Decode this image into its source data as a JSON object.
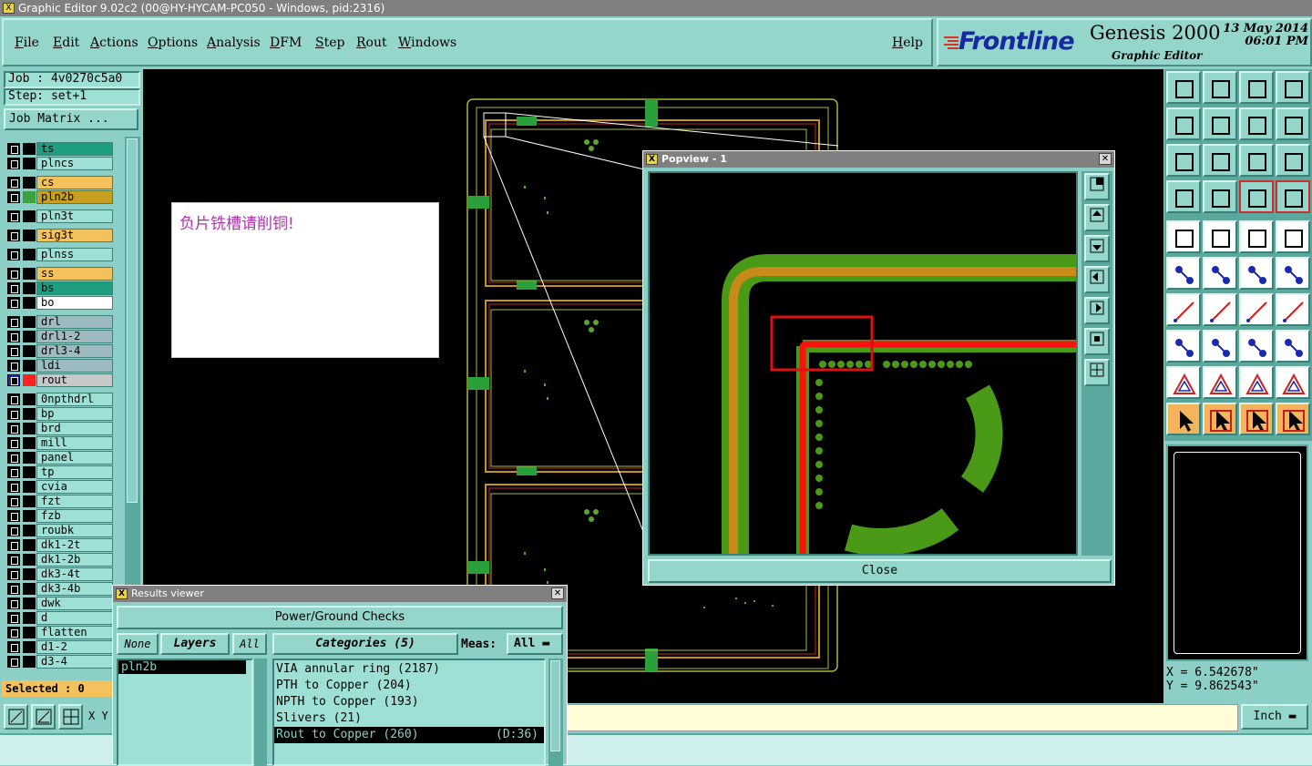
{
  "window": {
    "title": "Graphic Editor 9.02c2 (00@HY-HYCAM-PC050 - Windows, pid:2316)"
  },
  "menu": [
    "File",
    "Edit",
    "Actions",
    "Options",
    "Analysis",
    "DFM",
    "Step",
    "Rout",
    "Windows"
  ],
  "help": "Help",
  "brand": {
    "logo": "Frontline",
    "product": "Genesis 2000",
    "subtitle": "Graphic Editor",
    "date": "13 May 2014",
    "time": "06:01 PM"
  },
  "job": {
    "label": "Job : 4v0270c5a0",
    "step": "Step: set+1",
    "matrix_button": "Job Matrix ..."
  },
  "layers": [
    {
      "name": "ts",
      "color": "#1e9e7e",
      "swatch": "#000"
    },
    {
      "name": "plncs",
      "color": "#9ee0d6",
      "swatch": "#000"
    },
    {
      "name": "cs",
      "color": "#f4c25c",
      "swatch": "#000"
    },
    {
      "name": "pln2b",
      "color": "#c8a020",
      "swatch": "#3aa040"
    },
    {
      "name": "pln3t",
      "color": "#9ee0d6",
      "swatch": "#000"
    },
    {
      "name": "sig3t",
      "color": "#f4c25c",
      "swatch": "#000"
    },
    {
      "name": "plnss",
      "color": "#9ee0d6",
      "swatch": "#000"
    },
    {
      "name": "ss",
      "color": "#f4c25c",
      "swatch": "#000"
    },
    {
      "name": "bs",
      "color": "#1e9e7e",
      "swatch": "#000"
    },
    {
      "name": "bo",
      "color": "#ffffff",
      "swatch": "#000"
    },
    {
      "name": "drl",
      "color": "#9cbac0",
      "swatch": "#000"
    },
    {
      "name": "drl1-2",
      "color": "#9cbac0",
      "swatch": "#000"
    },
    {
      "name": "drl3-4",
      "color": "#9cbac0",
      "swatch": "#000"
    },
    {
      "name": "ldi",
      "color": "#9cbac0",
      "swatch": "#000"
    },
    {
      "name": "rout",
      "color": "#c8c8c8",
      "swatch": "#ff2020"
    },
    {
      "name": "0npthdrl",
      "color": "#9ee0d6",
      "swatch": "#000"
    },
    {
      "name": "bp",
      "color": "#9ee0d6",
      "swatch": "#000"
    },
    {
      "name": "brd",
      "color": "#9ee0d6",
      "swatch": "#000"
    },
    {
      "name": "mill",
      "color": "#9ee0d6",
      "swatch": "#000"
    },
    {
      "name": "panel",
      "color": "#9ee0d6",
      "swatch": "#000"
    },
    {
      "name": "tp",
      "color": "#9ee0d6",
      "swatch": "#000"
    },
    {
      "name": "cvia",
      "color": "#9ee0d6",
      "swatch": "#000"
    },
    {
      "name": "fzt",
      "color": "#9ee0d6",
      "swatch": "#000"
    },
    {
      "name": "fzb",
      "color": "#9ee0d6",
      "swatch": "#000"
    },
    {
      "name": "roubk",
      "color": "#9ee0d6",
      "swatch": "#000"
    },
    {
      "name": "dk1-2t",
      "color": "#9ee0d6",
      "swatch": "#000"
    },
    {
      "name": "dk1-2b",
      "color": "#9ee0d6",
      "swatch": "#000"
    },
    {
      "name": "dk3-4t",
      "color": "#9ee0d6",
      "swatch": "#000"
    },
    {
      "name": "dk3-4b",
      "color": "#9ee0d6",
      "swatch": "#000"
    },
    {
      "name": "dwk",
      "color": "#9ee0d6",
      "swatch": "#000"
    },
    {
      "name": "d",
      "color": "#9ee0d6",
      "swatch": "#000"
    },
    {
      "name": "flatten",
      "color": "#9ee0d6",
      "swatch": "#000"
    },
    {
      "name": "d1-2",
      "color": "#9ee0d6",
      "swatch": "#000"
    },
    {
      "name": "d3-4",
      "color": "#9ee0d6",
      "swatch": "#000"
    }
  ],
  "selected": "Selected : 0",
  "note": "负片铣槽请削铜!",
  "popview": {
    "title": "Popview - 1",
    "close": "Close"
  },
  "results": {
    "title": "Results viewer",
    "header": "Power/Ground Checks",
    "none": "None",
    "layers": "Layers",
    "all": "All",
    "categories": "Categories (5)",
    "meas_label": "Meas:",
    "meas_value": "All",
    "layer_items": [
      "pln2b"
    ],
    "items": [
      {
        "text": "VIA annular ring (2187)",
        "extra": ""
      },
      {
        "text": "PTH to Copper (204)",
        "extra": ""
      },
      {
        "text": "NPTH to Copper (193)",
        "extra": ""
      },
      {
        "text": "Slivers (21)",
        "extra": ""
      },
      {
        "text": "Rout to Copper (260)",
        "extra": "(D:36)"
      }
    ]
  },
  "coords": {
    "x": "X = 6.542678\"",
    "y": "Y = 9.862543\""
  },
  "units": "Inch",
  "statusbar_label": "X Y"
}
